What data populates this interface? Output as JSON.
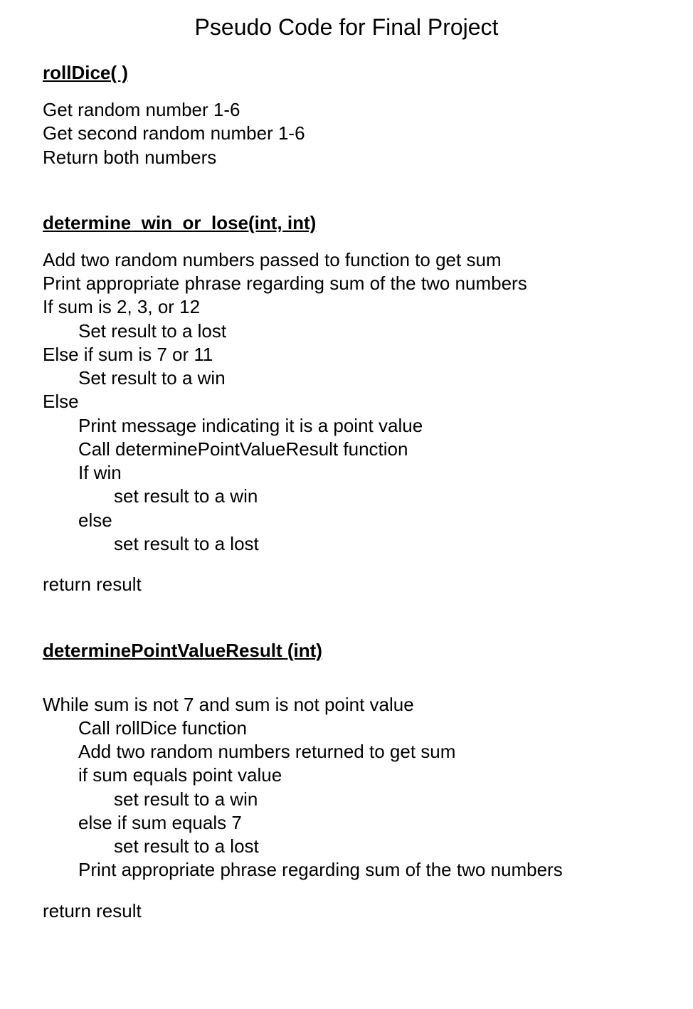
{
  "title": "Pseudo Code for Final Project",
  "sections": {
    "rollDice": {
      "heading": "rollDice( )",
      "lines": [
        {
          "text": "Get random number 1-6",
          "indent": 0
        },
        {
          "text": "Get second random number 1-6",
          "indent": 0
        },
        {
          "text": "Return both numbers",
          "indent": 0
        }
      ]
    },
    "determineWinOrLose": {
      "heading": "determine_win_or_lose(int, int)",
      "lines": [
        {
          "text": "Add two random numbers passed to function to get sum",
          "indent": 0
        },
        {
          "text": "Print appropriate phrase regarding sum of the two numbers",
          "indent": 0
        },
        {
          "text": "If sum is 2, 3, or 12",
          "indent": 0
        },
        {
          "text": "Set result to a lost",
          "indent": 1
        },
        {
          "text": "Else if sum is 7 or 11",
          "indent": 0
        },
        {
          "text": "Set result to a win",
          "indent": 1
        },
        {
          "text": "Else",
          "indent": 0
        },
        {
          "text": "Print message indicating it is a point value",
          "indent": 1
        },
        {
          "text": "Call determinePointValueResult function",
          "indent": 1
        },
        {
          "text": "If win",
          "indent": 1
        },
        {
          "text": "set result to a win",
          "indent": 2
        },
        {
          "text": "else",
          "indent": 1
        },
        {
          "text": "set result to a lost",
          "indent": 2
        }
      ],
      "return": "return result"
    },
    "determinePointValueResult": {
      "heading": "determinePointValueResult (int)",
      "lines": [
        {
          "text": "While sum is not 7 and sum is not point value",
          "indent": 0
        },
        {
          "text": "Call rollDice function",
          "indent": 1
        },
        {
          "text": "Add two random numbers returned to get sum",
          "indent": 1
        },
        {
          "text": "if sum equals point value",
          "indent": 1
        },
        {
          "text": "set result to a win",
          "indent": 2
        },
        {
          "text": "else if sum equals 7",
          "indent": 1
        },
        {
          "text": "set result to a lost",
          "indent": 2
        },
        {
          "text": "Print appropriate phrase regarding sum of the two numbers",
          "indent": 1
        }
      ],
      "return": "return result"
    }
  }
}
